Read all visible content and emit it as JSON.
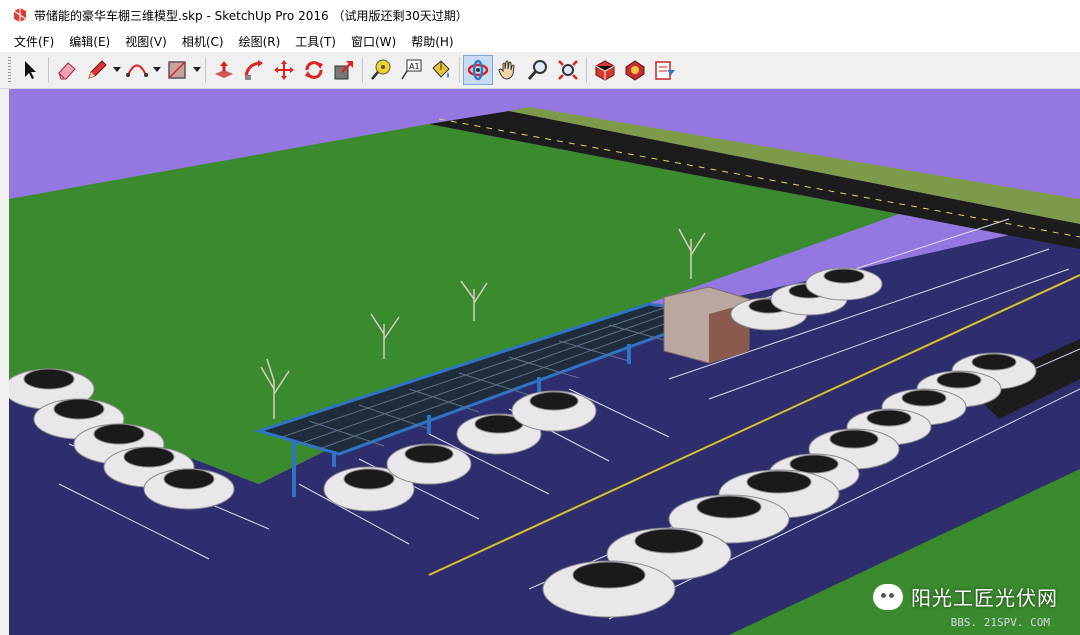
{
  "window": {
    "title": "带储能的豪华车棚三维模型.skp - SketchUp Pro 2016  （试用版还剩30天过期）",
    "icon": "sketchup-logo-icon"
  },
  "menu": [
    "文件(F)",
    "编辑(E)",
    "视图(V)",
    "相机(C)",
    "绘图(R)",
    "工具(T)",
    "窗口(W)",
    "帮助(H)"
  ],
  "toolbar": {
    "active_tool": "orbit",
    "text_tool_label": "A1",
    "tools": [
      "select",
      "eraser",
      "line",
      "arc",
      "shape",
      "push-pull",
      "follow-me",
      "move",
      "rotate",
      "scale",
      "tape-measure",
      "text",
      "paint-bucket",
      "orbit",
      "pan",
      "zoom",
      "zoom-extents",
      "3d-warehouse",
      "extension-warehouse",
      "send-to-layout"
    ]
  },
  "scene": {
    "sky_color": "#9477e0",
    "grass_color": "#3a8a2e",
    "parking_color": "#2e2e6e",
    "road_color": "#1c1c1c",
    "canopy_frame_color": "#2f74c4",
    "car_color": "#e8e8ea"
  },
  "watermark": {
    "text": "阳光工匠光伏网",
    "sub": "BBS. 21SPV. COM"
  }
}
